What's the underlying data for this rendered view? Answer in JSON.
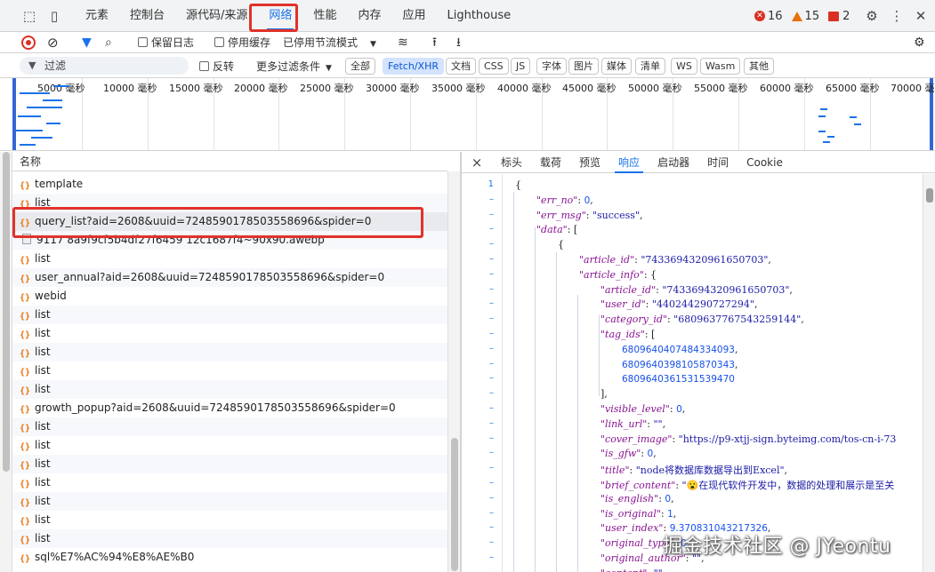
{
  "top_tabs": [
    "元素",
    "控制台",
    "源代码/来源",
    "网络",
    "性能",
    "内存",
    "应用",
    "Lighthouse"
  ],
  "active_tab": "网络",
  "counts": {
    "errors": "16",
    "warnings": "15",
    "issues": "2"
  },
  "toolbar": {
    "preserve_log": "保留日志",
    "disable_cache": "停用缓存",
    "throttling": "已停用节流模式"
  },
  "filter": {
    "placeholder": "过滤",
    "invert": "反转",
    "more_filters": "更多过滤条件",
    "types": [
      "全部",
      "Fetch/XHR",
      "文档",
      "CSS",
      "JS",
      "字体",
      "图片",
      "媒体",
      "清单",
      "WS",
      "Wasm",
      "其他"
    ],
    "selected_type": "Fetch/XHR"
  },
  "timeline": {
    "ticks": [
      "5000 毫秒",
      "10000 毫秒",
      "15000 毫秒",
      "20000 毫秒",
      "25000 毫秒",
      "30000 毫秒",
      "35000 毫秒",
      "40000 毫秒",
      "45000 毫秒",
      "50000 毫秒",
      "55000 毫秒",
      "60000 毫秒",
      "65000 毫秒",
      "70000 毫秒"
    ]
  },
  "requests": {
    "header": "名称",
    "rows": [
      {
        "name": "template",
        "type": "xhr"
      },
      {
        "name": "list",
        "type": "xhr"
      },
      {
        "name": "query_list?aid=2608&uuid=7248590178503558696&spider=0",
        "type": "xhr"
      },
      {
        "name": "9117 8a9f9cf5b4df27f6459 12c1687f4~90x90.awebp",
        "type": "img"
      },
      {
        "name": "list",
        "type": "xhr"
      },
      {
        "name": "user_annual?aid=2608&uuid=7248590178503558696&spider=0",
        "type": "xhr"
      },
      {
        "name": "webid",
        "type": "xhr"
      },
      {
        "name": "list",
        "type": "xhr"
      },
      {
        "name": "list",
        "type": "xhr"
      },
      {
        "name": "list",
        "type": "xhr"
      },
      {
        "name": "list",
        "type": "xhr"
      },
      {
        "name": "list",
        "type": "xhr"
      },
      {
        "name": "growth_popup?aid=2608&uuid=7248590178503558696&spider=0",
        "type": "xhr"
      },
      {
        "name": "list",
        "type": "xhr"
      },
      {
        "name": "list",
        "type": "xhr"
      },
      {
        "name": "list",
        "type": "xhr"
      },
      {
        "name": "list",
        "type": "xhr"
      },
      {
        "name": "list",
        "type": "xhr"
      },
      {
        "name": "list",
        "type": "xhr"
      },
      {
        "name": "list",
        "type": "xhr"
      },
      {
        "name": "sql%E7%AC%94%E8%AE%B0",
        "type": "xhr"
      }
    ],
    "selected_index": 2
  },
  "detail": {
    "close": "×",
    "tabs": [
      "标头",
      "载荷",
      "预览",
      "响应",
      "启动器",
      "时间",
      "Cookie"
    ],
    "active_tab": "响应"
  },
  "response_lines": [
    {
      "ln": "1",
      "indent": 0,
      "parts": [
        [
          "p",
          "{"
        ]
      ]
    },
    {
      "ln": "–",
      "indent": 1,
      "parts": [
        [
          "k",
          "\"err_no\""
        ],
        [
          "p",
          ": "
        ],
        [
          "n",
          "0"
        ],
        [
          "p",
          ","
        ]
      ]
    },
    {
      "ln": "–",
      "indent": 1,
      "parts": [
        [
          "k",
          "\"err_msg\""
        ],
        [
          "p",
          ": "
        ],
        [
          "s",
          "\"success\""
        ],
        [
          "p",
          ","
        ]
      ]
    },
    {
      "ln": "–",
      "indent": 1,
      "parts": [
        [
          "k",
          "\"data\""
        ],
        [
          "p",
          ": ["
        ]
      ]
    },
    {
      "ln": "–",
      "indent": 2,
      "parts": [
        [
          "p",
          "{"
        ]
      ]
    },
    {
      "ln": "–",
      "indent": 3,
      "parts": [
        [
          "k",
          "\"article_id\""
        ],
        [
          "p",
          ": "
        ],
        [
          "s",
          "\"7433694320961650703\""
        ],
        [
          "p",
          ","
        ]
      ]
    },
    {
      "ln": "–",
      "indent": 3,
      "parts": [
        [
          "k",
          "\"article_info\""
        ],
        [
          "p",
          ": {"
        ]
      ]
    },
    {
      "ln": "–",
      "indent": 4,
      "parts": [
        [
          "k",
          "\"article_id\""
        ],
        [
          "p",
          ": "
        ],
        [
          "s",
          "\"7433694320961650703\""
        ],
        [
          "p",
          ","
        ]
      ]
    },
    {
      "ln": "–",
      "indent": 4,
      "parts": [
        [
          "k",
          "\"user_id\""
        ],
        [
          "p",
          ": "
        ],
        [
          "s",
          "\"440244290727294\""
        ],
        [
          "p",
          ","
        ]
      ]
    },
    {
      "ln": "–",
      "indent": 4,
      "parts": [
        [
          "k",
          "\"category_id\""
        ],
        [
          "p",
          ": "
        ],
        [
          "s",
          "\"6809637767543259144\""
        ],
        [
          "p",
          ","
        ]
      ]
    },
    {
      "ln": "–",
      "indent": 4,
      "parts": [
        [
          "k",
          "\"tag_ids\""
        ],
        [
          "p",
          ": ["
        ]
      ]
    },
    {
      "ln": "–",
      "indent": 5,
      "parts": [
        [
          "n",
          "6809640407484334093"
        ],
        [
          "p",
          ","
        ]
      ]
    },
    {
      "ln": "–",
      "indent": 5,
      "parts": [
        [
          "n",
          "6809640398105870343"
        ],
        [
          "p",
          ","
        ]
      ]
    },
    {
      "ln": "–",
      "indent": 5,
      "parts": [
        [
          "n",
          "6809640361531539470"
        ]
      ]
    },
    {
      "ln": "–",
      "indent": 4,
      "parts": [
        [
          "p",
          "],"
        ]
      ]
    },
    {
      "ln": "–",
      "indent": 4,
      "parts": [
        [
          "k",
          "\"visible_level\""
        ],
        [
          "p",
          ": "
        ],
        [
          "n",
          "0"
        ],
        [
          "p",
          ","
        ]
      ]
    },
    {
      "ln": "–",
      "indent": 4,
      "parts": [
        [
          "k",
          "\"link_url\""
        ],
        [
          "p",
          ": "
        ],
        [
          "s",
          "\"\""
        ],
        [
          "p",
          ","
        ]
      ]
    },
    {
      "ln": "–",
      "indent": 4,
      "parts": [
        [
          "k",
          "\"cover_image\""
        ],
        [
          "p",
          ": "
        ],
        [
          "s",
          "\"https://p9-xtjj-sign.byteimg.com/tos-cn-i-73"
        ]
      ]
    },
    {
      "ln": "–",
      "indent": 4,
      "parts": [
        [
          "k",
          "\"is_gfw\""
        ],
        [
          "p",
          ": "
        ],
        [
          "n",
          "0"
        ],
        [
          "p",
          ","
        ]
      ]
    },
    {
      "ln": "–",
      "indent": 4,
      "parts": [
        [
          "k",
          "\"title\""
        ],
        [
          "p",
          ": "
        ],
        [
          "s",
          "\"node将数据库数据导出到Excel\""
        ],
        [
          "p",
          ","
        ]
      ]
    },
    {
      "ln": "–",
      "indent": 4,
      "parts": [
        [
          "k",
          "\"brief_content\""
        ],
        [
          "p",
          ": "
        ],
        [
          "s",
          "\"😮在现代软件开发中，数据的处理和展示是至关"
        ]
      ]
    },
    {
      "ln": "–",
      "indent": 4,
      "parts": [
        [
          "k",
          "\"is_english\""
        ],
        [
          "p",
          ": "
        ],
        [
          "n",
          "0"
        ],
        [
          "p",
          ","
        ]
      ]
    },
    {
      "ln": "–",
      "indent": 4,
      "parts": [
        [
          "k",
          "\"is_original\""
        ],
        [
          "p",
          ": "
        ],
        [
          "n",
          "1"
        ],
        [
          "p",
          ","
        ]
      ]
    },
    {
      "ln": "–",
      "indent": 4,
      "parts": [
        [
          "k",
          "\"user_index\""
        ],
        [
          "p",
          ": "
        ],
        [
          "n",
          "9.370831043217326"
        ],
        [
          "p",
          ","
        ]
      ]
    },
    {
      "ln": "–",
      "indent": 4,
      "parts": [
        [
          "k",
          "\"original_type\""
        ],
        [
          "p",
          ": "
        ],
        [
          "n",
          "0"
        ],
        [
          "p",
          ","
        ]
      ]
    },
    {
      "ln": "–",
      "indent": 4,
      "parts": [
        [
          "k",
          "\"original_author\""
        ],
        [
          "p",
          ": "
        ],
        [
          "s",
          "\"\""
        ],
        [
          "p",
          ","
        ]
      ]
    },
    {
      "ln": "–",
      "indent": 4,
      "parts": [
        [
          "k",
          "\"content\""
        ],
        [
          "p",
          ": "
        ],
        [
          "s",
          "\"\""
        ],
        [
          "p",
          ","
        ]
      ]
    }
  ],
  "watermark": "掘金技术社区 @ JYeontu",
  "colors": {
    "accent": "#1a73e8",
    "highlight": "#e0322b",
    "error": "#d93025",
    "warning": "#e8710a"
  }
}
